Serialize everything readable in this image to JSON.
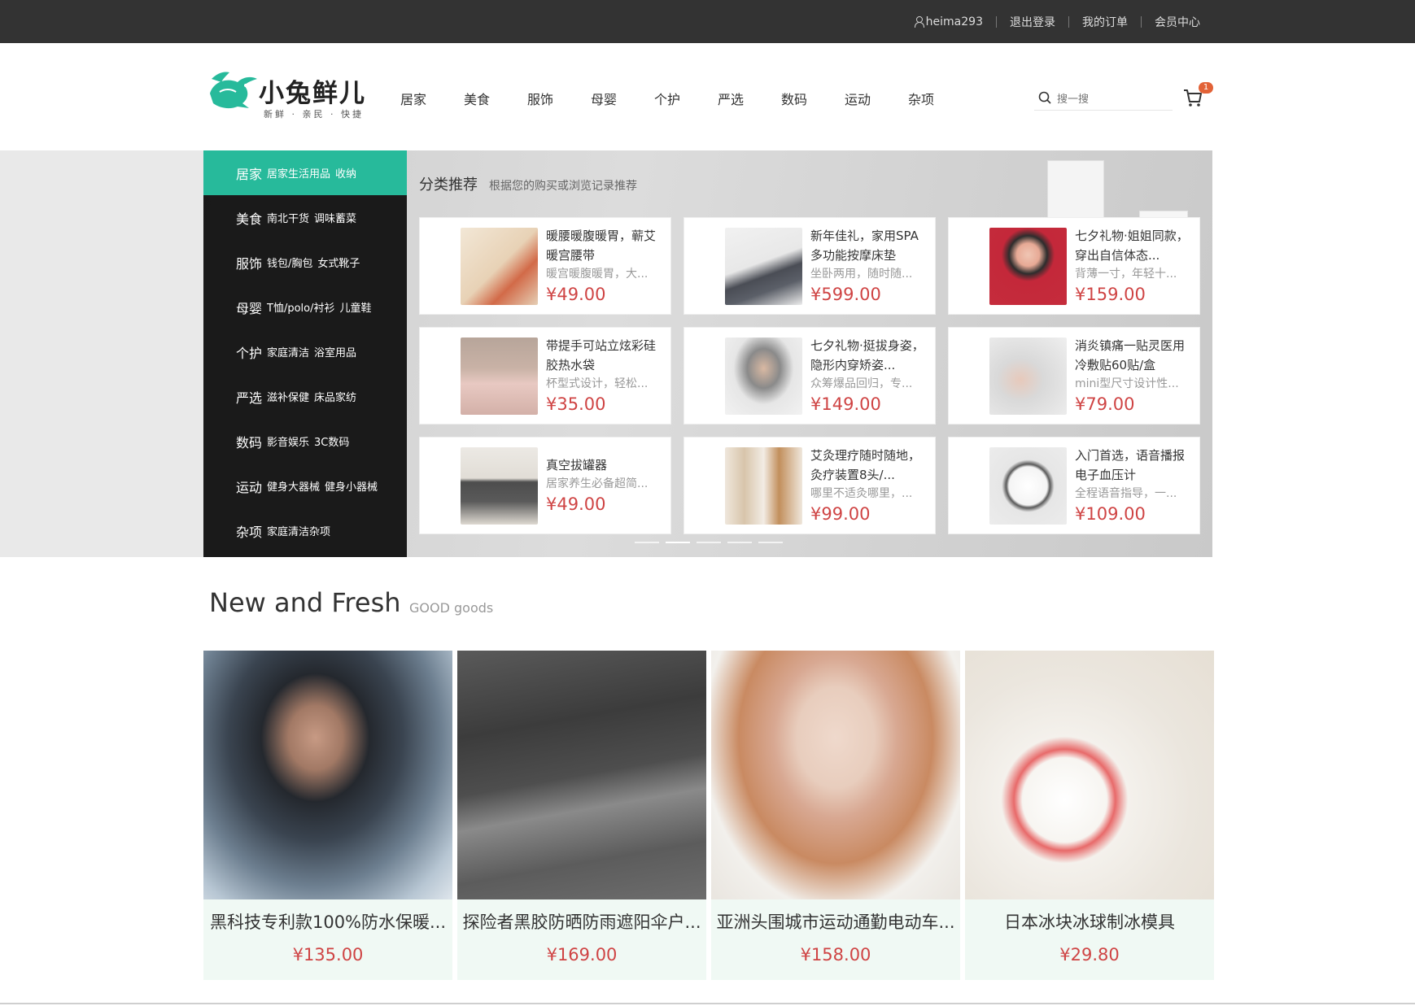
{
  "topbar": {
    "username": "heima293",
    "links": [
      "退出登录",
      "我的订单",
      "会员中心"
    ]
  },
  "header": {
    "logo_text": "小兔鲜儿",
    "logo_sub": "新鲜 · 亲民 · 快捷",
    "nav": [
      "居家",
      "美食",
      "服饰",
      "母婴",
      "个护",
      "严选",
      "数码",
      "运动",
      "杂项"
    ],
    "search_placeholder": "搜一搜",
    "cart_count": "1",
    "accent": "#27ba9b"
  },
  "categories": [
    {
      "name": "居家",
      "subs": [
        "居家生活用品",
        "收纳"
      ]
    },
    {
      "name": "美食",
      "subs": [
        "南北干货",
        "调味蓄菜"
      ]
    },
    {
      "name": "服饰",
      "subs": [
        "钱包/胸包",
        "女式靴子"
      ]
    },
    {
      "name": "母婴",
      "subs": [
        "T恤/polo/衬衫",
        "儿童鞋"
      ]
    },
    {
      "name": "个护",
      "subs": [
        "家庭清洁",
        "浴室用品"
      ]
    },
    {
      "name": "严选",
      "subs": [
        "滋补保健",
        "床品家纺"
      ]
    },
    {
      "name": "数码",
      "subs": [
        "影音娱乐",
        "3C数码"
      ]
    },
    {
      "name": "运动",
      "subs": [
        "健身大器械",
        "健身小器械"
      ]
    },
    {
      "name": "杂项",
      "subs": [
        "家庭清洁杂项"
      ]
    }
  ],
  "recommend": {
    "title": "分类推荐",
    "tip": "根据您的购买或浏览记录推荐",
    "items": [
      {
        "name": "暖腰暖腹暖胃，蕲艾暖宫腰带",
        "desc": "暖宫暖腹暖胃，大...",
        "price": "¥49.00"
      },
      {
        "name": "新年佳礼，家用SPA多功能按摩床垫",
        "desc": "坐卧两用，随时随...",
        "price": "¥599.00"
      },
      {
        "name": "七夕礼物·姐姐同款，穿出自信体态...",
        "desc": "背薄一寸，年轻十...",
        "price": "¥159.00"
      },
      {
        "name": "带提手可站立炫彩硅胶热水袋",
        "desc": "杯型式设计，轻松...",
        "price": "¥35.00"
      },
      {
        "name": "七夕礼物·挺拔身姿，隐形内穿矫姿...",
        "desc": "众筹爆品回归，专...",
        "price": "¥149.00"
      },
      {
        "name": "消炎镇痛一贴灵医用冷敷贴60贴/盒",
        "desc": "mini型尺寸设计性...",
        "price": "¥79.00"
      },
      {
        "name": "真空拔罐器",
        "desc": "居家养生必备超简...",
        "price": "¥49.00"
      },
      {
        "name": "艾灸理疗随时随地，灸疗装置8头/...",
        "desc": "哪里不适灸哪里，...",
        "price": "¥99.00"
      },
      {
        "name": "入门首选，语音播报电子血压计",
        "desc": "全程语音指导，一...",
        "price": "¥109.00"
      }
    ]
  },
  "fresh": {
    "title": "New and Fresh",
    "sub": "GOOD goods",
    "items": [
      {
        "name": "黑科技专利款100%防水保暖...",
        "price": "¥135.00"
      },
      {
        "name": "探险者黑胶防晒防雨遮阳伞户...",
        "price": "¥169.00"
      },
      {
        "name": "亚洲头围城市运动通勤电动车...",
        "price": "¥158.00"
      },
      {
        "name": "日本冰块冰球制冰模具",
        "price": "¥29.80"
      }
    ]
  }
}
